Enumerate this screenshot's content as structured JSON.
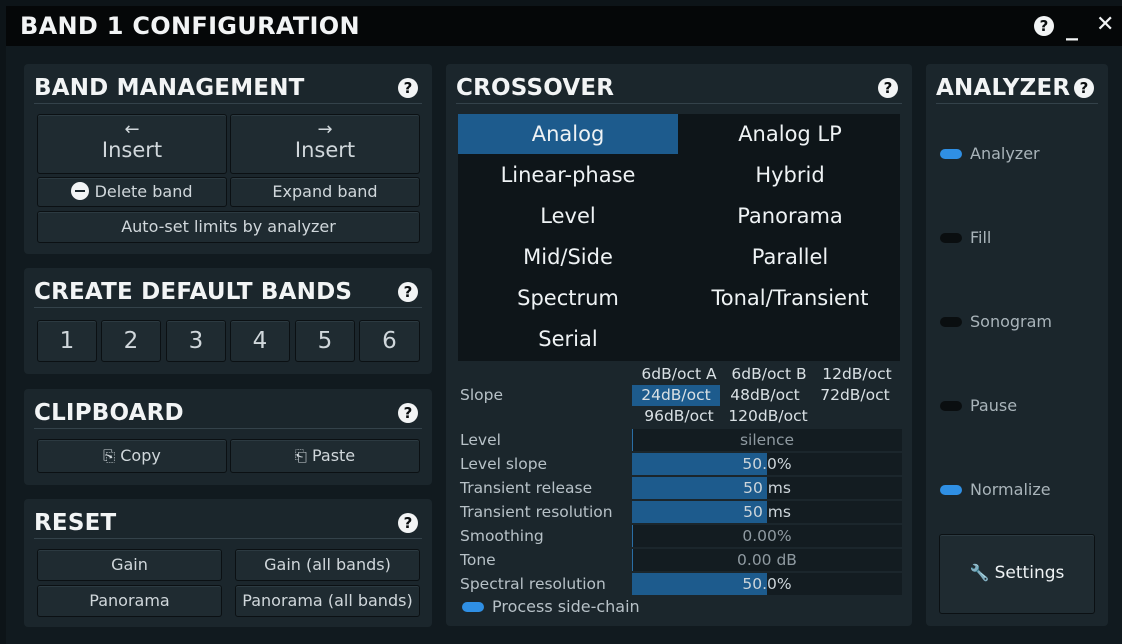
{
  "window": {
    "title": "BAND 1 CONFIGURATION",
    "help": "?",
    "minimize": "_",
    "close": "✕"
  },
  "band_management": {
    "title": "BAND MANAGEMENT",
    "insert_left_arrow": "←",
    "insert_left": "Insert",
    "insert_right_arrow": "→",
    "insert_right": "Insert",
    "delete_band": "Delete band",
    "expand_band": "Expand band",
    "auto_set": "Auto-set limits by analyzer"
  },
  "create_default_bands": {
    "title": "CREATE DEFAULT BANDS",
    "buttons": [
      "1",
      "2",
      "3",
      "4",
      "5",
      "6"
    ]
  },
  "clipboard": {
    "title": "CLIPBOARD",
    "copy": "Copy",
    "paste": "Paste"
  },
  "reset": {
    "title": "RESET",
    "gain": "Gain",
    "gain_all": "Gain (all bands)",
    "panorama": "Panorama",
    "panorama_all": "Panorama (all bands)"
  },
  "crossover": {
    "title": "CROSSOVER",
    "options": [
      "Analog",
      "Analog LP",
      "Linear-phase",
      "Hybrid",
      "Level",
      "Panorama",
      "Mid/Side",
      "Parallel",
      "Spectrum",
      "Tonal/Transient",
      "Serial"
    ],
    "selected": "Analog",
    "slope_label": "Slope",
    "slope_options": [
      "6dB/oct A",
      "6dB/oct B",
      "12dB/oct",
      "24dB/oct",
      "48dB/oct",
      "72dB/oct",
      "96dB/oct",
      "120dB/oct"
    ],
    "slope_selected": "24dB/oct",
    "params": [
      {
        "label": "Level",
        "value": "silence",
        "fill": 0.0
      },
      {
        "label": "Level slope",
        "value": "50.0%",
        "fill": 0.5
      },
      {
        "label": "Transient release",
        "value": "50 ms",
        "fill": 0.5
      },
      {
        "label": "Transient resolution",
        "value": "50 ms",
        "fill": 0.5
      },
      {
        "label": "Smoothing",
        "value": "0.00%",
        "fill": 0.0
      },
      {
        "label": "Tone",
        "value": "0.00 dB",
        "fill": 0.0
      },
      {
        "label": "Spectral resolution",
        "value": "50.0%",
        "fill": 0.5
      }
    ],
    "process_sidechain": "Process side-chain",
    "process_sidechain_on": true
  },
  "analyzer": {
    "title": "ANALYZER",
    "items": [
      {
        "label": "Analyzer",
        "on": true
      },
      {
        "label": "Fill",
        "on": false
      },
      {
        "label": "Sonogram",
        "on": false
      },
      {
        "label": "Pause",
        "on": false
      },
      {
        "label": "Normalize",
        "on": true
      }
    ],
    "settings": "Settings"
  },
  "colors": {
    "accent": "#1d5b8d",
    "toggle_on": "#2f8fe4",
    "panel": "#1b262c",
    "background": "#111a1f"
  }
}
